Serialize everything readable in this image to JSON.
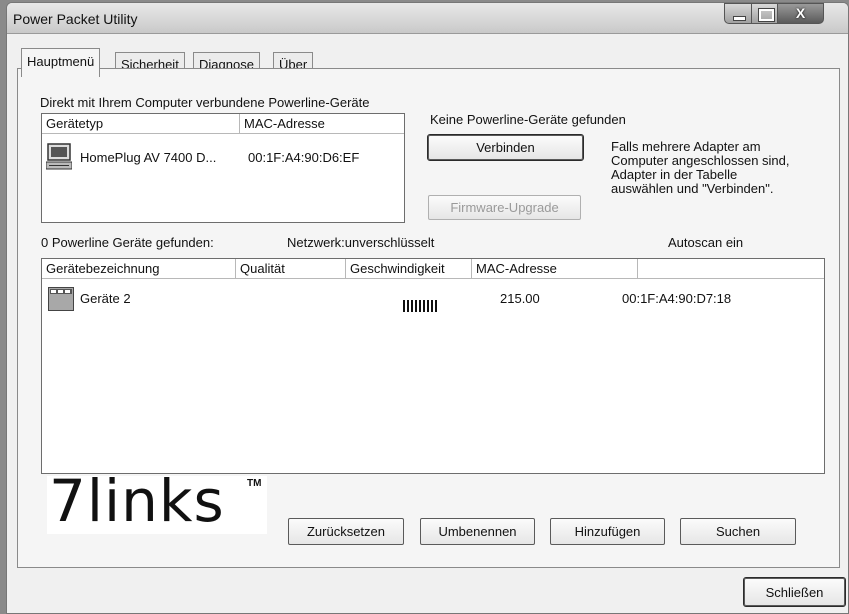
{
  "window": {
    "title": "Power Packet Utility",
    "close_glyph": "X"
  },
  "tabs": [
    {
      "label": "Hauptmenü"
    },
    {
      "label": "Sicherheit"
    },
    {
      "label": "Diagnose"
    },
    {
      "label": "Über"
    }
  ],
  "local_devices": {
    "heading": "Direkt mit Ihrem Computer verbundene Powerline-Geräte",
    "columns": [
      "Gerätetyp",
      "MAC-Adresse"
    ],
    "rows": [
      {
        "icon": "computer-icon",
        "type": "HomePlug AV 7400 D...",
        "mac": "00:1F:A4:90:D6:EF"
      }
    ]
  },
  "status_text": "Keine Powerline-Geräte gefunden",
  "connect_button": "Verbinden",
  "firmware_button": "Firmware-Upgrade",
  "hint_lines": [
    "Falls mehrere Adapter am",
    "Computer angeschlossen sind,",
    "Adapter in der Tabelle",
    "auswählen und \"Verbinden\"."
  ],
  "network": {
    "found_text": "0 Powerline Geräte gefunden:",
    "network_text": "Netzwerk:unverschlüsselt",
    "autoscan_text": "Autoscan ein"
  },
  "remote_devices": {
    "columns": [
      "Gerätebezeichnung",
      "Qualität",
      "Geschwindigkeit",
      "MAC-Adresse",
      ""
    ],
    "rows": [
      {
        "icon": "powerline-adapter-icon",
        "name": "Geräte 2",
        "quality_bars": "quality-bars-icon",
        "speed": "215.00",
        "mac": "00:1F:A4:90:D7:18"
      }
    ]
  },
  "logo": {
    "text": "7links",
    "tm": "TM"
  },
  "buttons": {
    "reset": "Zurücksetzen",
    "rename": "Umbenennen",
    "add": "Hinzufügen",
    "search": "Suchen",
    "close": "Schließen"
  }
}
